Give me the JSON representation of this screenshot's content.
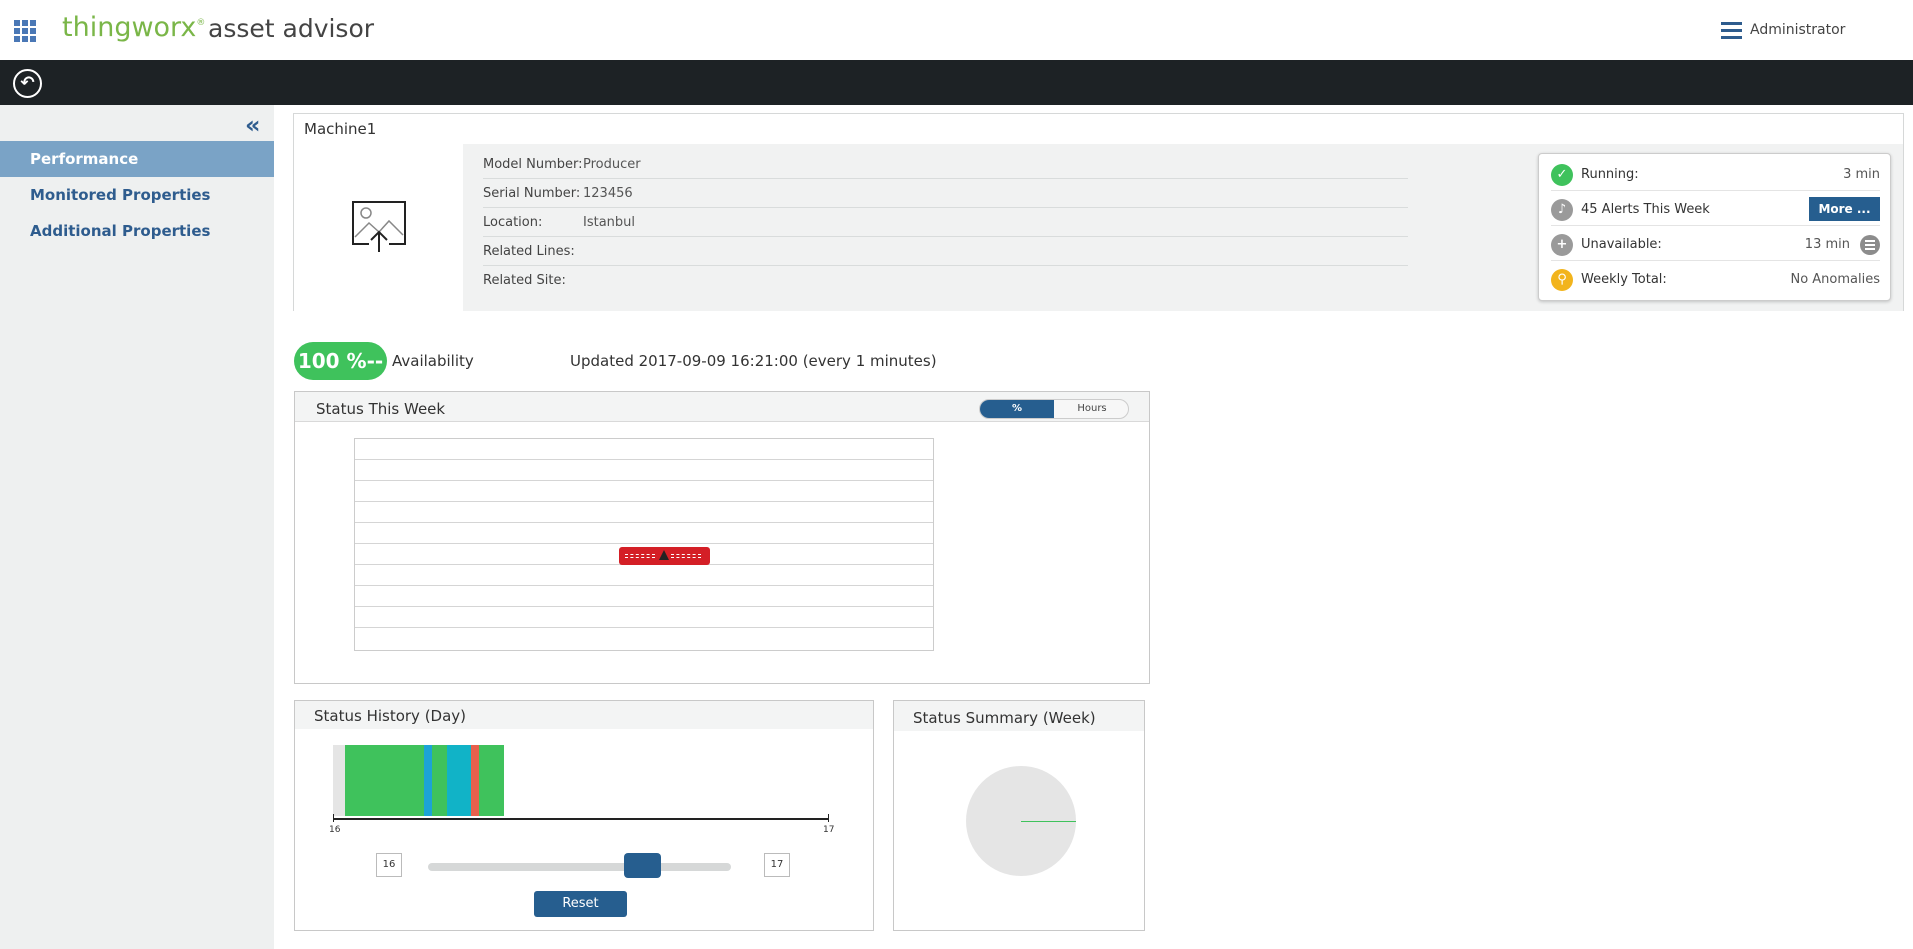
{
  "header": {
    "brand": "thingworx",
    "brand_reg": "®",
    "product": "asset advisor",
    "user": "Administrator"
  },
  "sidebar": {
    "items": [
      {
        "label": "Performance",
        "active": true
      },
      {
        "label": "Monitored Properties",
        "active": false
      },
      {
        "label": "Additional Properties",
        "active": false
      }
    ]
  },
  "machine": {
    "name": "Machine1",
    "properties": [
      {
        "label": "Model Number:",
        "value": "Producer"
      },
      {
        "label": "Serial Number:",
        "value": "123456"
      },
      {
        "label": "Location:",
        "value": "Istanbul"
      },
      {
        "label": "Related Lines:",
        "value": ""
      },
      {
        "label": "Related Site:",
        "value": ""
      }
    ],
    "status": {
      "running_label": "Running:",
      "running_value": "3 min",
      "alerts_label": "45 Alerts This Week",
      "more_label": "More ...",
      "unavailable_label": "Unavailable:",
      "unavailable_value": "13 min",
      "weekly_label": "Weekly Total:",
      "weekly_value": "No Anomalies"
    }
  },
  "availability": {
    "value": "100 %--",
    "label": "Availability",
    "updated": "Updated 2017-09-09 16:21:00 (every 1 minutes)"
  },
  "status_week": {
    "title": "Status This Week",
    "toggle_pct": "%",
    "toggle_hours": "Hours"
  },
  "status_history": {
    "title": "Status History (Day)",
    "axis_start": "16",
    "axis_end": "17",
    "range_start": "16",
    "range_end": "17",
    "reset_label": "Reset",
    "colors": {
      "running": "#3fc25c",
      "idle": "#1ca3d6",
      "alarm": "#e8604c",
      "unavailable": "#e5e5e5"
    }
  },
  "status_summary": {
    "title": "Status Summary (Week)"
  }
}
